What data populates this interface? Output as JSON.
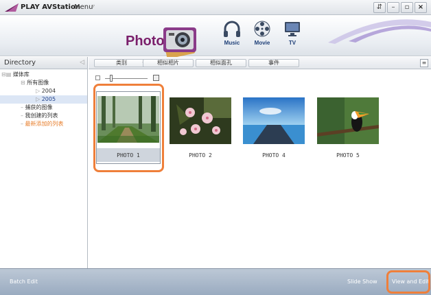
{
  "titlebar": {
    "app_title": "PLAY AVStation",
    "menu_label": "Menu",
    "menu_caret": "▿",
    "buttons": {
      "restore": "⇵",
      "minimize": "–",
      "maximize": "▫",
      "close": "×"
    }
  },
  "header": {
    "current_section": "Photo",
    "nav": [
      {
        "label": "Music",
        "icon": "headphones-icon"
      },
      {
        "label": "Movie",
        "icon": "film-reel-icon"
      },
      {
        "label": "TV",
        "icon": "monitor-icon"
      }
    ],
    "accent_color": "#7a1f6b"
  },
  "directory": {
    "title": "Directory",
    "collapse_glyph": "◁",
    "tree": [
      {
        "label": "媒体库",
        "level": 0
      },
      {
        "label": "所有图像",
        "level": 1
      },
      {
        "label": "2004",
        "level": 2
      },
      {
        "label": "2005",
        "level": 2,
        "selected": true
      },
      {
        "label": "捕获的图像",
        "level": 1
      },
      {
        "label": "我创建的列表",
        "level": 1
      },
      {
        "label": "最新添加的列表",
        "level": 1,
        "highlight": true
      }
    ]
  },
  "toolbar": {
    "category": "类别",
    "caret": "▾",
    "similar_photos": "相似相片",
    "similar_faces": "相似面孔",
    "events": "事件",
    "view_toggle": "≡"
  },
  "zoom": {
    "level": 0.15
  },
  "photos": [
    {
      "caption": "PHOTO 1",
      "selected": true,
      "scene": "forest"
    },
    {
      "caption": "PHOTO 2",
      "selected": false,
      "scene": "flowers"
    },
    {
      "caption": "PHOTO 4",
      "selected": false,
      "scene": "pier"
    },
    {
      "caption": "PHOTO 5",
      "selected": false,
      "scene": "toucan"
    }
  ],
  "bottombar": {
    "batch_edit": "Batch Edit",
    "slide_show": "Slide Show",
    "view_and_edit": "View and Edit"
  },
  "colors": {
    "callout": "#ef7f3a",
    "selection": "#dce6f5",
    "highlight_text": "#e77d2a"
  }
}
